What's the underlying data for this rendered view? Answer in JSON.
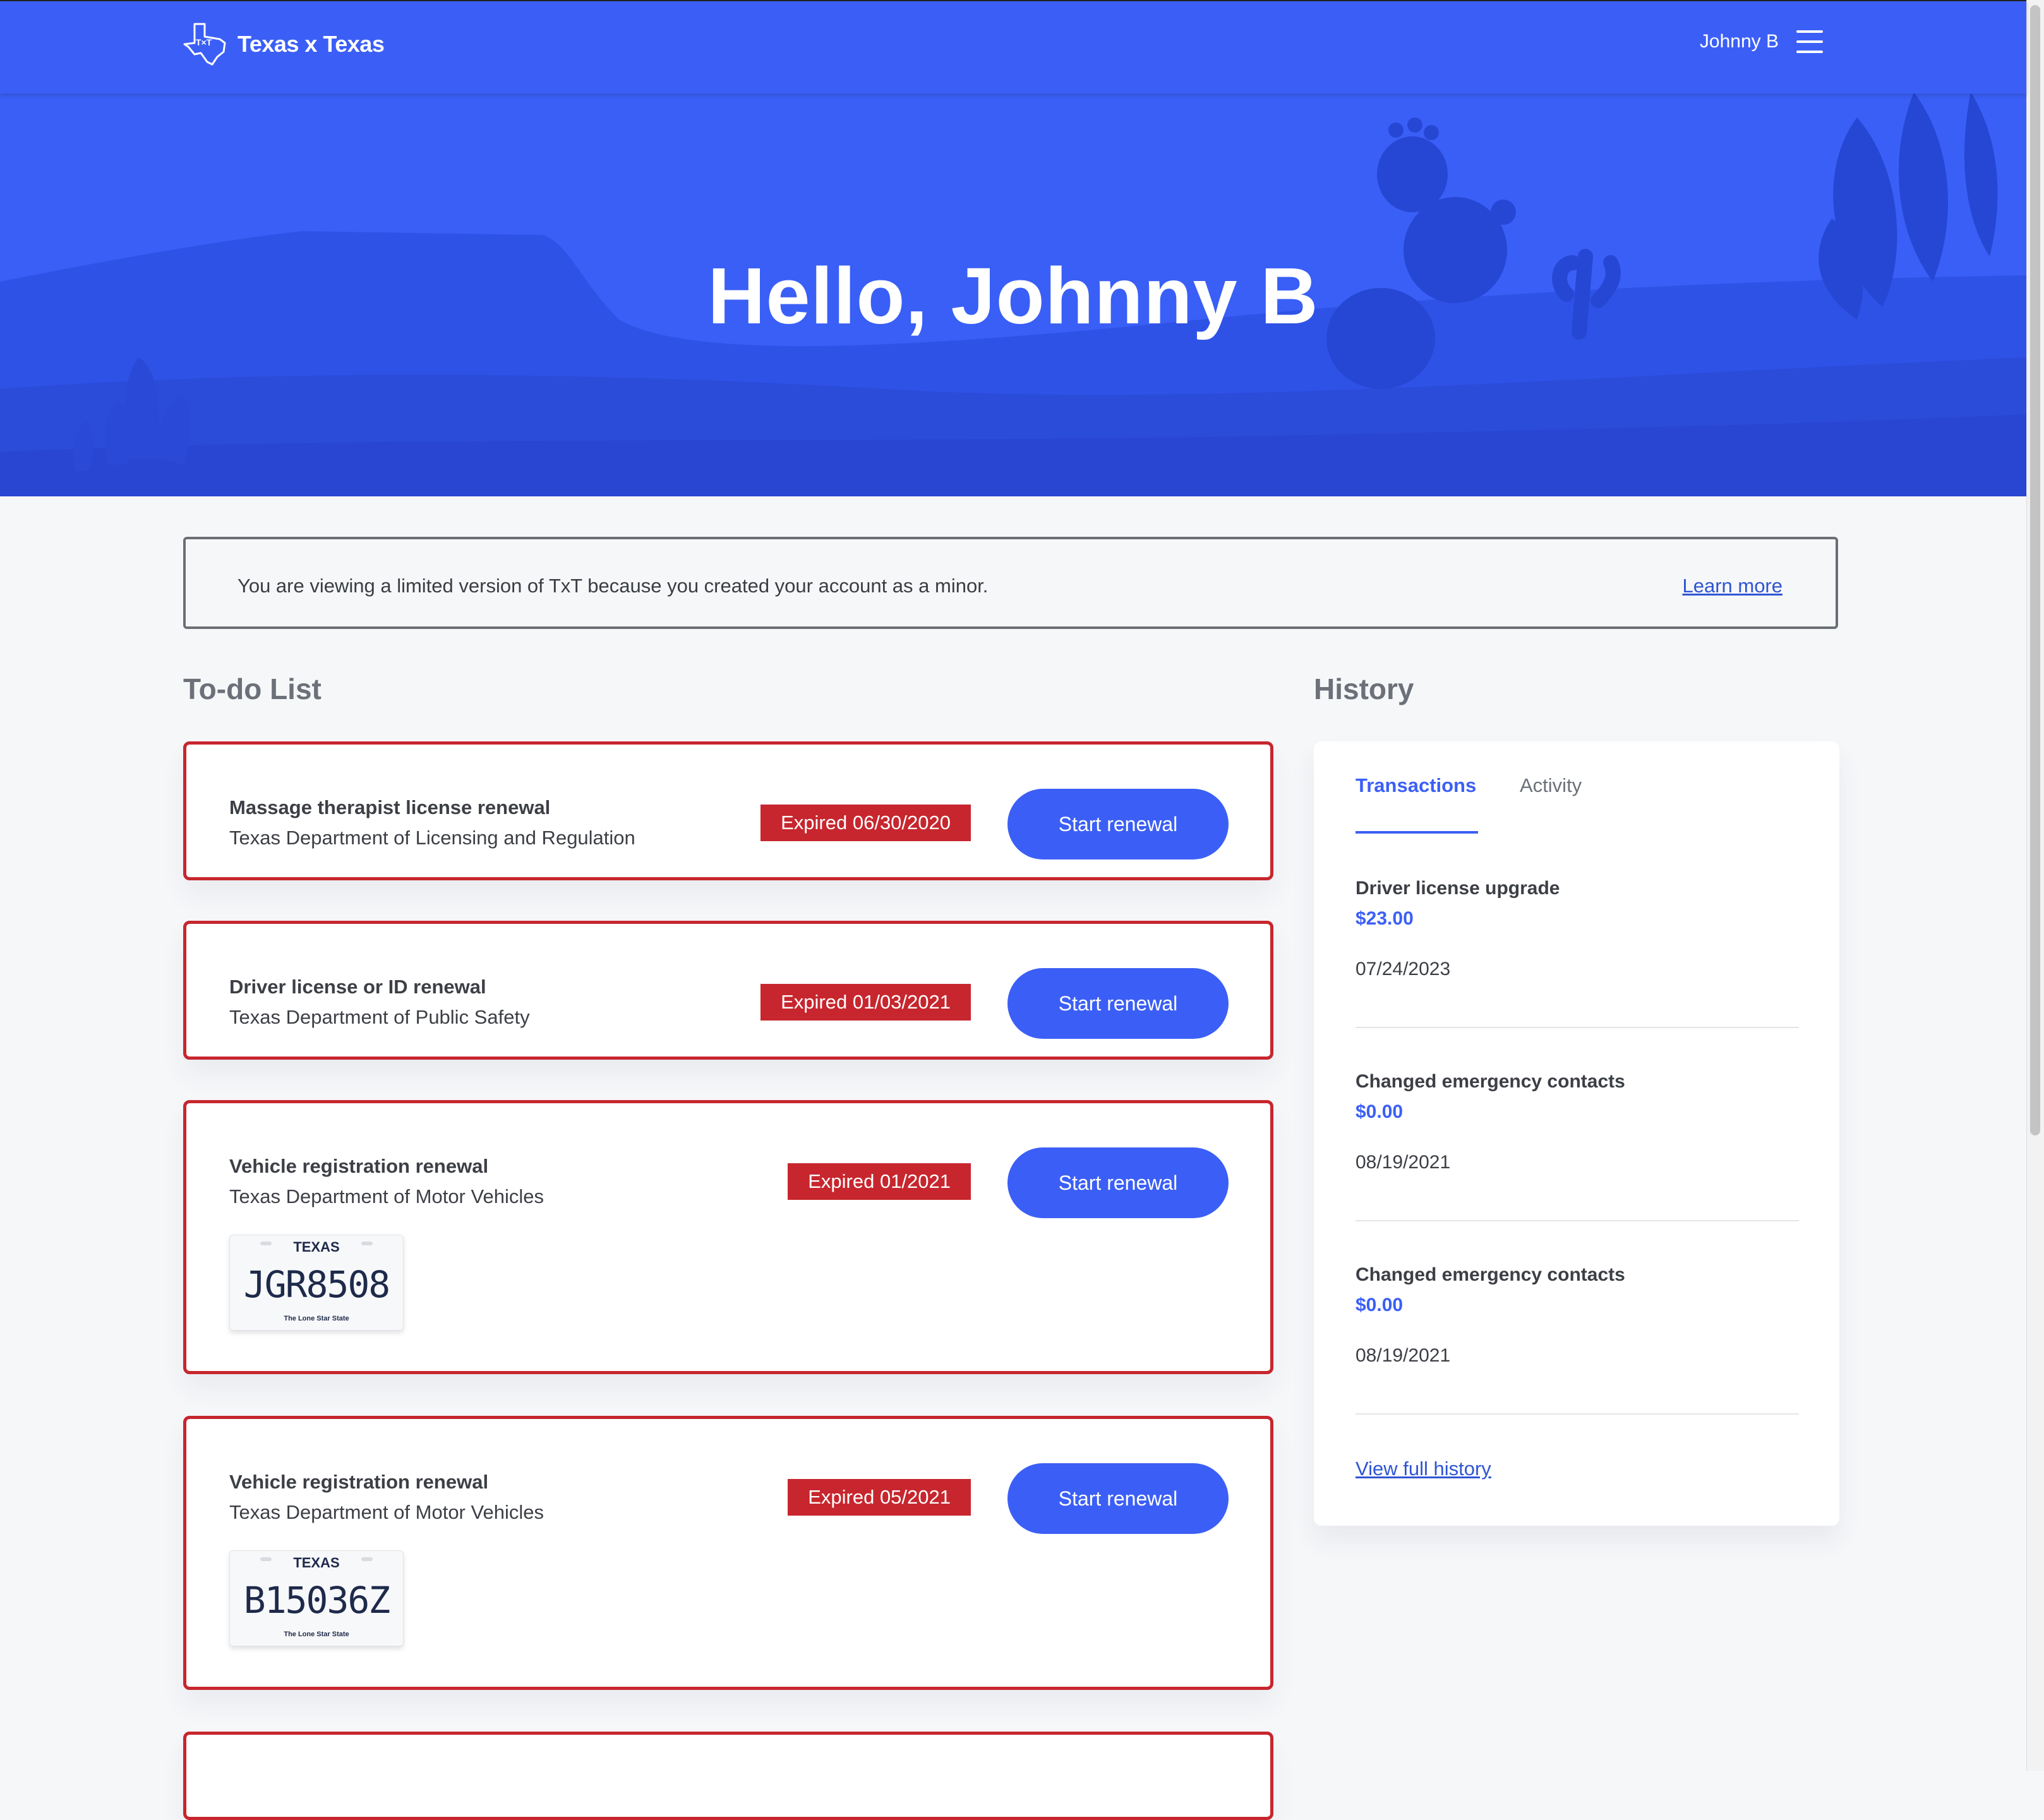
{
  "header": {
    "brand": "Texas x Texas",
    "logo_text": "T×T",
    "user_name": "Johnny B"
  },
  "hero": {
    "greeting": "Hello, Johnny B"
  },
  "notice": {
    "text": "You are viewing a limited version of TxT because you created your account as a minor.",
    "link": "Learn more"
  },
  "todo": {
    "heading": "To-do List",
    "items": [
      {
        "title": "Massage therapist license renewal",
        "agency": "Texas Department of Licensing and Regulation",
        "status": "Expired 06/30/2020",
        "action": "Start renewal"
      },
      {
        "title": "Driver license or ID renewal",
        "agency": "Texas Department of Public Safety",
        "status": "Expired 01/03/2021",
        "action": "Start renewal"
      },
      {
        "title": "Vehicle registration renewal",
        "agency": "Texas Department of Motor Vehicles",
        "status": "Expired 01/2021",
        "action": "Start renewal",
        "plate": {
          "state": "TEXAS",
          "number": "JGR8508",
          "motto": "The Lone Star State"
        }
      },
      {
        "title": "Vehicle registration renewal",
        "agency": "Texas Department of Motor Vehicles",
        "status": "Expired 05/2021",
        "action": "Start renewal",
        "plate": {
          "state": "TEXAS",
          "number": "B15036Z",
          "motto": "The Lone Star State"
        }
      }
    ]
  },
  "history": {
    "heading": "History",
    "tabs": [
      {
        "label": "Transactions",
        "active": true
      },
      {
        "label": "Activity",
        "active": false
      }
    ],
    "transactions": [
      {
        "title": "Driver license upgrade",
        "amount": "$23.00",
        "date": "07/24/2023"
      },
      {
        "title": "Changed emergency contacts",
        "amount": "$0.00",
        "date": "08/19/2021"
      },
      {
        "title": "Changed emergency contacts",
        "amount": "$0.00",
        "date": "08/19/2021"
      }
    ],
    "view_all": "View full history"
  },
  "colors": {
    "primary": "#3b5ff6",
    "danger": "#c7262e",
    "page_bg": "#f6f7f9"
  }
}
